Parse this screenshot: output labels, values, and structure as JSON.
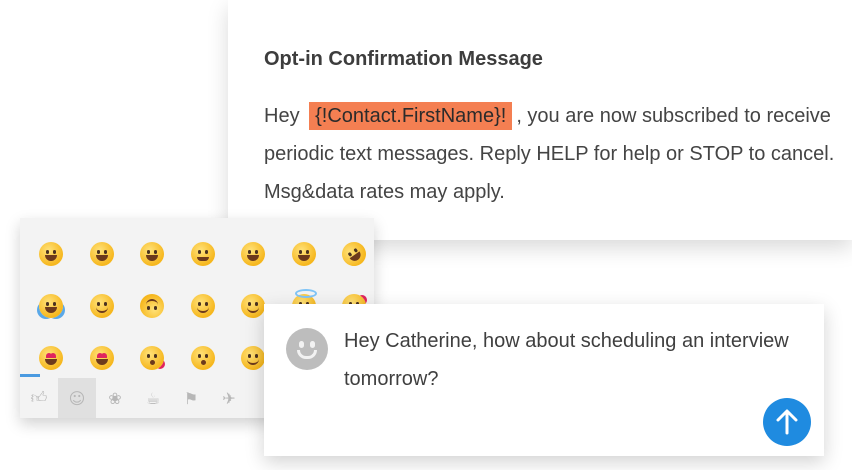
{
  "optin": {
    "title": "Opt-in Confirmation Message",
    "body_prefix": "Hey ",
    "merge_tag": "{!Contact.FirstName}!",
    "body_suffix": ", you are now subscribed to receive periodic text messages. Reply HELP for help or STOP to cancel. Msg&data rates may apply.",
    "merge_tag_color": "#f47f52"
  },
  "emoji_panel": {
    "rows": [
      [
        "grinning-face",
        "grinning-face-big-eyes",
        "grinning-face-smiling-eyes",
        "beaming-face",
        "grinning-squinting-face",
        "grinning-face-sweat",
        "rolling-on-floor-laughing"
      ],
      [
        "face-tears-of-joy",
        "slightly-smiling-face",
        "upside-down-face",
        "winking-face",
        "smiling-face-smiling-eyes",
        "smiling-face-halo",
        "smiling-face-hearts"
      ],
      [
        "heart-eyes",
        "star-struck",
        "face-blowing-kiss",
        "kissing-face",
        "smiling-face"
      ]
    ],
    "tabs": [
      "thumbs-up-icon",
      "smiley-icon",
      "paw-icon",
      "food-icon",
      "activity-icon",
      "running-icon"
    ],
    "active_tab": "smiley-icon"
  },
  "chat": {
    "message": "Hey Catherine, how about scheduling an interview tomorrow?",
    "send_color": "#1f8be0"
  }
}
